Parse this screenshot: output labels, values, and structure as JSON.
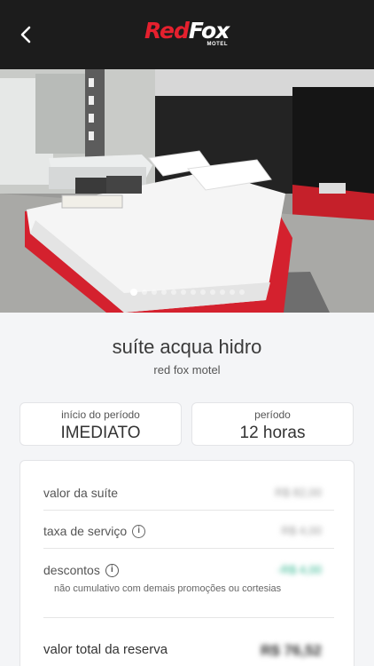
{
  "header": {
    "back_icon": "chevron-left-icon",
    "logo": {
      "part1": "Red",
      "part2": "Fox",
      "sub": "MOTEL"
    },
    "colors": {
      "background": "#1c1c1c",
      "brand_red": "#e5202e"
    }
  },
  "gallery": {
    "photo": "suite-bedroom-photo",
    "dot_count": 12,
    "active_index": 0
  },
  "room": {
    "title": "suíte acqua hidro",
    "motel": "red fox motel"
  },
  "period": {
    "start_label": "início do período",
    "start_value": "IMEDIATO",
    "duration_label": "período",
    "duration_value": "12 horas"
  },
  "summary": {
    "suite_label": "valor da suíte",
    "suite_value": "R$ 82,00",
    "fee_label": "taxa de serviço",
    "fee_value": "R$ 4,00",
    "discount_label": "descontos",
    "discount_value": "-R$ 4,00",
    "discount_note": "não cumulativo com demais promoções ou cortesias",
    "total_label": "valor total da reserva",
    "total_value": "R$ 76,52",
    "colors": {
      "discount": "#27b38a"
    }
  }
}
